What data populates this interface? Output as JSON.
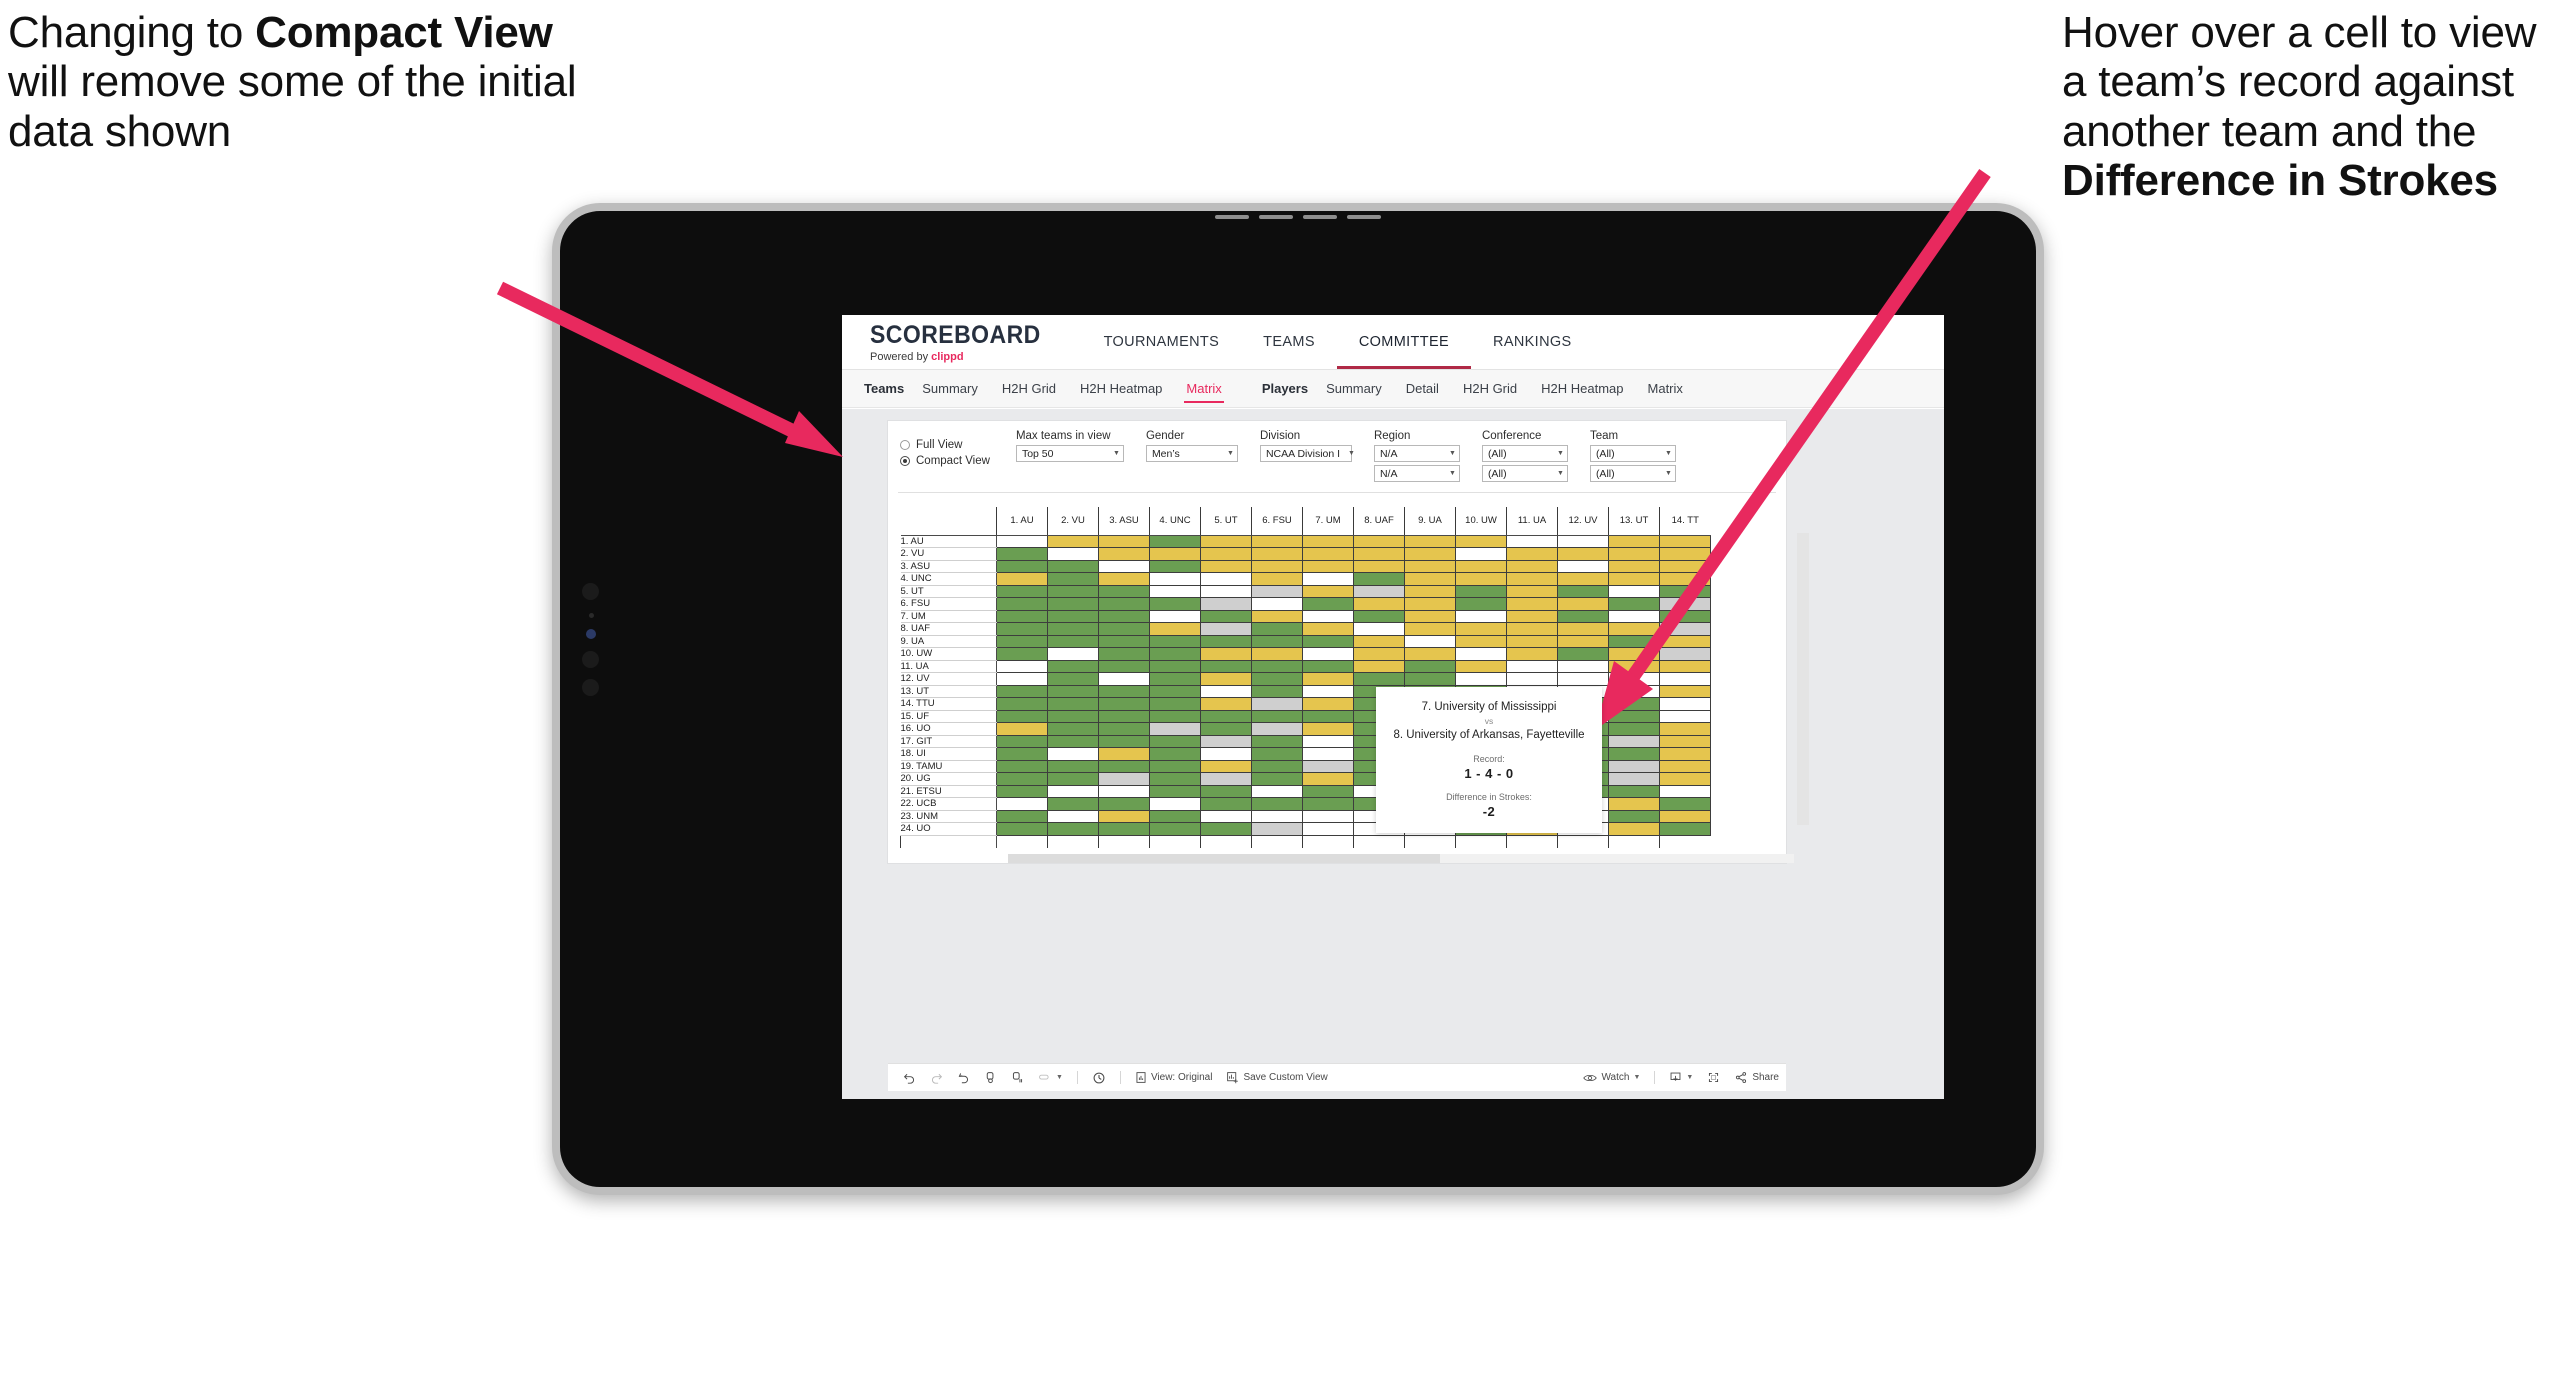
{
  "annotations": {
    "left": {
      "pre": "Changing to ",
      "bold": "Compact View",
      "post": " will remove some of the initial data shown"
    },
    "right": {
      "pre": "Hover over a cell to view a team’s record against another team and the ",
      "bold": "Difference in Strokes",
      "post": ""
    },
    "arrow_color": "#e8295e"
  },
  "app": {
    "brand": {
      "title": "SCOREBOARD",
      "powered_prefix": "Powered by ",
      "powered_name": "clippd"
    },
    "top_nav": [
      {
        "label": "TOURNAMENTS",
        "active": false
      },
      {
        "label": "TEAMS",
        "active": false
      },
      {
        "label": "COMMITTEE",
        "active": true
      },
      {
        "label": "RANKINGS",
        "active": false
      }
    ],
    "sub_nav": {
      "teams_label": "Teams",
      "teams_items": [
        {
          "label": "Summary",
          "active": false
        },
        {
          "label": "H2H Grid",
          "active": false
        },
        {
          "label": "H2H Heatmap",
          "active": false
        },
        {
          "label": "Matrix",
          "active": true
        }
      ],
      "players_label": "Players",
      "players_items": [
        {
          "label": "Summary",
          "active": false
        },
        {
          "label": "Detail",
          "active": false
        },
        {
          "label": "H2H Grid",
          "active": false
        },
        {
          "label": "H2H Heatmap",
          "active": false
        },
        {
          "label": "Matrix",
          "active": false
        }
      ]
    },
    "filters": {
      "view_options": [
        {
          "label": "Full View",
          "selected": false
        },
        {
          "label": "Compact View",
          "selected": true
        }
      ],
      "max_teams": {
        "label": "Max teams in view",
        "value": "Top 50"
      },
      "gender": {
        "label": "Gender",
        "value": "Men’s"
      },
      "division": {
        "label": "Division",
        "value": "NCAA Division I"
      },
      "region": {
        "label": "Region",
        "value1": "N/A",
        "value2": "N/A"
      },
      "conference": {
        "label": "Conference",
        "value1": "(All)",
        "value2": "(All)"
      },
      "team": {
        "label": "Team",
        "value1": "(All)",
        "value2": "(All)"
      }
    },
    "tooltip": {
      "team_a": "7. University of Mississippi",
      "vs": "vs",
      "team_b": "8. University of Arkansas, Fayetteville",
      "record_label": "Record:",
      "record_value": "1 - 4 - 0",
      "strokes_label": "Difference in Strokes:",
      "strokes_value": "-2"
    },
    "toolbar": {
      "undo": "undo-icon",
      "redo": "redo-icon",
      "revert": "revert-icon",
      "refresh": "refresh-data-icon",
      "pause": "pause-auto-update-icon",
      "view_original": "View: Original",
      "save_custom_view": "Save Custom View",
      "watch": "Watch",
      "share": "Share"
    }
  },
  "chart_data": {
    "type": "heatmap",
    "title": "Team Head-to-Head Matrix",
    "legend": {
      "green": "#6a9e52",
      "yellow": "#e5c54e",
      "white": "#ffffff",
      "grey": "#cfcfcf"
    },
    "columns": [
      "1. AU",
      "2. VU",
      "3. ASU",
      "4. UNC",
      "5. UT",
      "6. FSU",
      "7. UM",
      "8. UAF",
      "9. UA",
      "10. UW",
      "11. UA",
      "12. UV",
      "13. UT",
      "14. TT"
    ],
    "rows": [
      "1. AU",
      "2. VU",
      "3. ASU",
      "4. UNC",
      "5. UT",
      "6. FSU",
      "7. UM",
      "8. UAF",
      "9. UA",
      "10. UW",
      "11. UA",
      "12. UV",
      "13. UT",
      "14. TTU",
      "15. UF",
      "16. UO",
      "17. GIT",
      "18. UI",
      "19. TAMU",
      "20. UG",
      "21. ETSU",
      "22. UCB",
      "23. UNM",
      "24. UO"
    ],
    "cells": [
      [
        "w",
        "y",
        "y",
        "g",
        "y",
        "y",
        "y",
        "y",
        "y",
        "y",
        "w",
        "w",
        "y",
        "y"
      ],
      [
        "g",
        "w",
        "y",
        "y",
        "y",
        "y",
        "y",
        "y",
        "y",
        "w",
        "y",
        "y",
        "y",
        "y"
      ],
      [
        "g",
        "g",
        "w",
        "g",
        "y",
        "y",
        "y",
        "y",
        "y",
        "y",
        "y",
        "w",
        "y",
        "y"
      ],
      [
        "y",
        "g",
        "y",
        "w",
        "w",
        "y",
        "w",
        "g",
        "y",
        "y",
        "y",
        "y",
        "y",
        "y"
      ],
      [
        "g",
        "g",
        "g",
        "w",
        "w",
        "s",
        "y",
        "s",
        "y",
        "g",
        "y",
        "g",
        "w",
        "g"
      ],
      [
        "g",
        "g",
        "g",
        "g",
        "s",
        "w",
        "g",
        "y",
        "y",
        "g",
        "y",
        "y",
        "g",
        "s"
      ],
      [
        "g",
        "g",
        "g",
        "w",
        "g",
        "y",
        "w",
        "g",
        "y",
        "w",
        "y",
        "g",
        "w",
        "g"
      ],
      [
        "g",
        "g",
        "g",
        "y",
        "s",
        "g",
        "y",
        "w",
        "y",
        "y",
        "y",
        "y",
        "y",
        "s"
      ],
      [
        "g",
        "g",
        "g",
        "g",
        "g",
        "g",
        "g",
        "y",
        "w",
        "y",
        "y",
        "y",
        "g",
        "y"
      ],
      [
        "g",
        "w",
        "g",
        "g",
        "y",
        "y",
        "w",
        "y",
        "y",
        "w",
        "y",
        "g",
        "y",
        "s"
      ],
      [
        "w",
        "g",
        "g",
        "g",
        "g",
        "g",
        "g",
        "y",
        "g",
        "y",
        "w",
        "w",
        "y",
        "y"
      ],
      [
        "w",
        "g",
        "w",
        "g",
        "y",
        "g",
        "y",
        "g",
        "g",
        "w",
        "w",
        "w",
        "w",
        "w"
      ],
      [
        "g",
        "g",
        "g",
        "g",
        "w",
        "g",
        "w",
        "g",
        "g",
        "g",
        "w",
        "w",
        "w",
        "y"
      ],
      [
        "g",
        "g",
        "g",
        "g",
        "y",
        "s",
        "y",
        "g",
        "g",
        "y",
        "s",
        "g",
        "g",
        "w"
      ],
      [
        "g",
        "g",
        "g",
        "g",
        "g",
        "g",
        "g",
        "g",
        "s",
        "g",
        "w",
        "w",
        "g",
        "w"
      ],
      [
        "y",
        "g",
        "g",
        "s",
        "g",
        "s",
        "y",
        "g",
        "g",
        "w",
        "s",
        "g",
        "g",
        "y"
      ],
      [
        "g",
        "g",
        "g",
        "g",
        "s",
        "g",
        "w",
        "g",
        "g",
        "y",
        "s",
        "g",
        "s",
        "y"
      ],
      [
        "g",
        "w",
        "y",
        "g",
        "w",
        "g",
        "w",
        "g",
        "g",
        "g",
        "w",
        "g",
        "g",
        "y"
      ],
      [
        "g",
        "g",
        "g",
        "g",
        "y",
        "g",
        "s",
        "g",
        "y",
        "g",
        "g",
        "g",
        "s",
        "y"
      ],
      [
        "g",
        "g",
        "s",
        "g",
        "s",
        "g",
        "y",
        "g",
        "g",
        "w",
        "w",
        "g",
        "s",
        "y"
      ],
      [
        "g",
        "w",
        "w",
        "g",
        "g",
        "w",
        "g",
        "w",
        "w",
        "y",
        "g",
        "g",
        "g",
        "w"
      ],
      [
        "w",
        "g",
        "g",
        "w",
        "g",
        "g",
        "g",
        "g",
        "w",
        "g",
        "y",
        "w",
        "y",
        "g"
      ],
      [
        "g",
        "w",
        "y",
        "g",
        "w",
        "w",
        "w",
        "w",
        "w",
        "y",
        "g",
        "w",
        "g",
        "y"
      ],
      [
        "g",
        "g",
        "g",
        "g",
        "g",
        "s",
        "w",
        "w",
        "w",
        "g",
        "y",
        "w",
        "y",
        "g"
      ]
    ]
  }
}
